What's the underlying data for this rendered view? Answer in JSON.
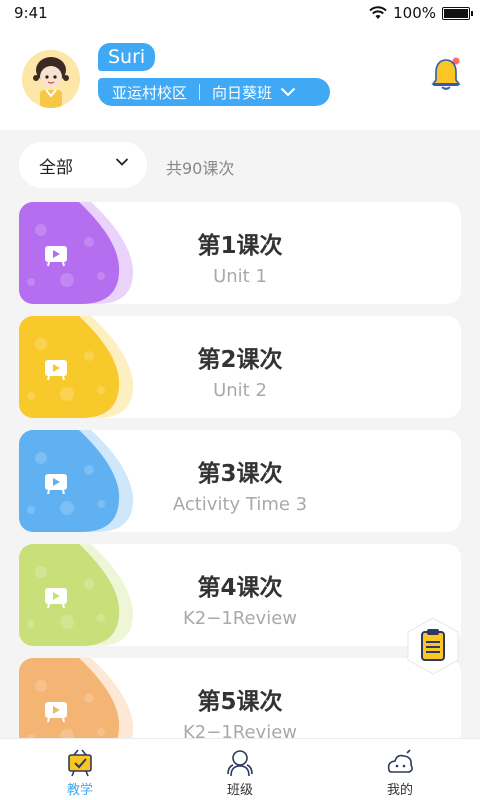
{
  "status_bar": {
    "time": "9:41",
    "battery": "100%"
  },
  "header": {
    "user_name": "Suri",
    "campus": "亚运村校区",
    "class_name": "向日葵班"
  },
  "filter": {
    "selected": "全部",
    "count_text": "共90课次"
  },
  "lessons": [
    {
      "title": "第1课次",
      "subtitle": "Unit 1",
      "color": "#b56ef0"
    },
    {
      "title": "第2课次",
      "subtitle": "Unit 2",
      "color": "#f8c92a"
    },
    {
      "title": "第3课次",
      "subtitle": "Activity Time 3",
      "color": "#5fb1f2"
    },
    {
      "title": "第4课次",
      "subtitle": "K2−1Review",
      "color": "#c9e07a"
    },
    {
      "title": "第5课次",
      "subtitle": "K2−1Review",
      "color": "#f4b473"
    }
  ],
  "tabs": [
    {
      "label": "教学",
      "icon": "teaching-icon",
      "active": true
    },
    {
      "label": "班级",
      "icon": "class-icon",
      "active": false
    },
    {
      "label": "我的",
      "icon": "profile-icon",
      "active": false
    }
  ],
  "colors": {
    "accent": "#3fa9f5"
  }
}
